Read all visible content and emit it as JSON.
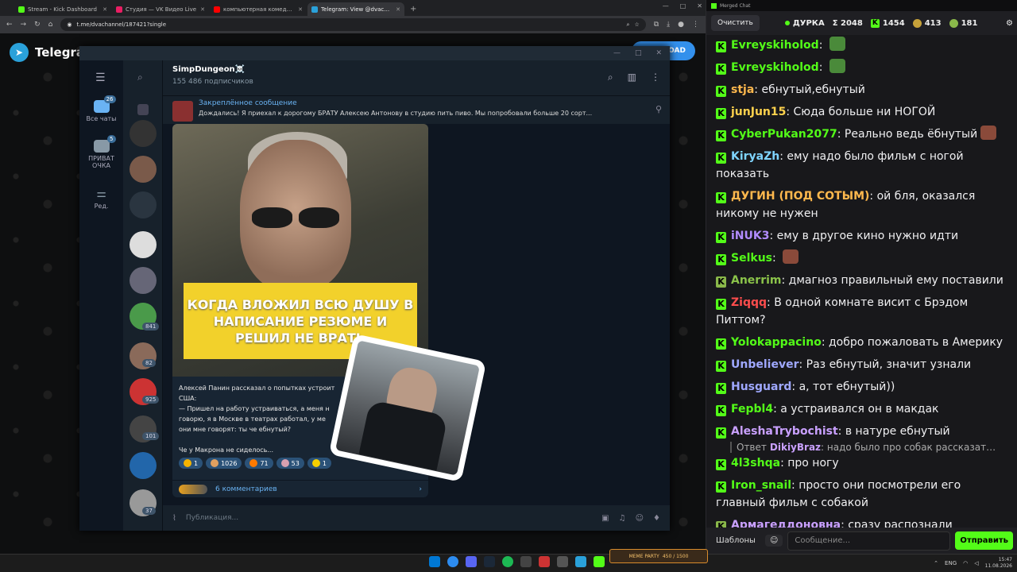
{
  "browser": {
    "tabs": [
      {
        "title": "Stream - Kick Dashboard",
        "color": "#53fc18"
      },
      {
        "title": "Студия — VK Видео Live",
        "color": "#e91e63"
      },
      {
        "title": "компьютерная комедия, копь",
        "color": "#ff0000"
      },
      {
        "title": "Telegram: View @dvachannel",
        "color": "#2aa1da"
      }
    ],
    "url": "t.me/dvachannel/187421?single"
  },
  "telegram": {
    "brand": "Telegram",
    "download_label": "OAD",
    "rail": [
      {
        "label": "Все чаты",
        "badge": "26"
      },
      {
        "label": "ПРИВАТ ОЧКА",
        "badge": "5"
      },
      {
        "label": "Ред.",
        "badge": ""
      }
    ],
    "chat_badges": [
      "841",
      "82",
      "925",
      "101",
      "37"
    ],
    "channel_name": "SimpDungeon☠️",
    "subscribers": "155 486 подписчиков",
    "pinned_title": "Закреплённое сообщение",
    "pinned_text": "Дождались!  Я приехал к дорогому БРАТУ Алексею Антонову в студию пить пиво. Мы попробовали больше 20 сорт...",
    "video_caption": "КОГДА ВЛОЖИЛ ВСЮ ДУШУ В НАПИСАНИЕ РЕЗЮМЕ И РЕШИЛ НЕ ВРАТЬ",
    "message_lines": [
      "Алексей Панин рассказал о попытках устроит",
      "США:",
      "— Пришел на работу устраиваться, а меня н",
      "говорю, я в Москве в театрах работал, у ме",
      "они мне говорят: ты че ебнутый?",
      "",
      "Че у Макрона не сиделось..."
    ],
    "reactions": [
      {
        "count": "1",
        "color": "#f5b400"
      },
      {
        "count": "1026",
        "color": "#e0a060"
      },
      {
        "count": "71",
        "color": "#ff7a00"
      },
      {
        "count": "53",
        "color": "#d8a0b0"
      },
      {
        "count": "1",
        "color": "#f5d000"
      }
    ],
    "comments": "6 комментариев",
    "input_placeholder": "Публикация..."
  },
  "chat": {
    "window_title": "Merged Chat",
    "clear_label": "Очистить",
    "channel": "ДУРКА",
    "total": "Σ 2048",
    "kick_count": "1454",
    "vk_count": "413",
    "other_count": "181",
    "messages": [
      {
        "user": "Evreyskiholod",
        "color": "#53fc18",
        "text": "",
        "emote": "#4a8a3a"
      },
      {
        "user": "Evreyskiholod",
        "color": "#53fc18",
        "text": "",
        "emote": "#4a8a3a"
      },
      {
        "user": "stja",
        "color": "#ffb84d",
        "text": "ебнутый,ебнутый",
        "emote": ""
      },
      {
        "user": "junJun15",
        "color": "#ffd24d",
        "text": "Сюда больше ни НОГОЙ",
        "emote": ""
      },
      {
        "user": "CyberPukan2077",
        "color": "#53fc18",
        "text": "Реально ведь ёбнутый",
        "emote": "#8a4a3a"
      },
      {
        "user": "KiryaZh",
        "color": "#7fd4ff",
        "text": "ему надо было фильм с ногой показать",
        "emote": ""
      },
      {
        "user": "ДУГИН (ПОД СОТЫМ)",
        "color": "#ffb84d",
        "text": "ой бля, оказался никому не нужен",
        "emote": ""
      },
      {
        "user": "iNUK3",
        "color": "#b28cff",
        "text": "ему в другое кино нужно идти",
        "emote": ""
      },
      {
        "user": "Selkus",
        "color": "#53fc18",
        "text": "",
        "emote": "#8a4a3a"
      },
      {
        "user": "Anerrim",
        "color": "#8bc34a",
        "text": "дмагноз правильный ему поставили",
        "emote": ""
      },
      {
        "user": "Ziqqq",
        "color": "#ff4d4d",
        "text": "В одной комнате висит с Брэдом Питтом?",
        "emote": ""
      },
      {
        "user": "Yolokappacino",
        "color": "#53fc18",
        "text": "добро пожаловать в Америку",
        "emote": ""
      },
      {
        "user": "Unbeliever",
        "color": "#9fa8ff",
        "text": "Раз ебнутый, значит узнали",
        "emote": ""
      },
      {
        "user": "Husguard",
        "color": "#9fa8ff",
        "text": "а, тот ебнутый))",
        "emote": ""
      },
      {
        "user": "Fepbl4",
        "color": "#53fc18",
        "text": "а устраивался он в макдак",
        "emote": ""
      },
      {
        "user": "AleshaTrybochist",
        "color": "#c9a0ff",
        "text": "в натуре ебнутый",
        "emote": ""
      },
      {
        "user": "4l3shqa",
        "color": "#53fc18",
        "text": "про ногу",
        "emote": ""
      },
      {
        "user": "Iron_snail",
        "color": "#53fc18",
        "text": "просто они посмотрели его главный фильм с собакой",
        "emote": ""
      },
      {
        "user": "Армагеддоновна",
        "color": "#c9a0ff",
        "text": "сразу распознали ебнутого, хороший HR",
        "emote": ""
      }
    ],
    "reply": {
      "prefix": "Ответ",
      "user": "DikiyBraz",
      "text": "надо было про собак рассказать. узнал..."
    },
    "templates_label": "Шаблоны",
    "input_placeholder": "Сообщение...",
    "send_label": "Отправить"
  },
  "taskbar": {
    "meme": "MEME PARTY",
    "meme_progress": "450 / 1500",
    "lang": "ENG",
    "time": "15:47",
    "date": "11.08.2026"
  }
}
